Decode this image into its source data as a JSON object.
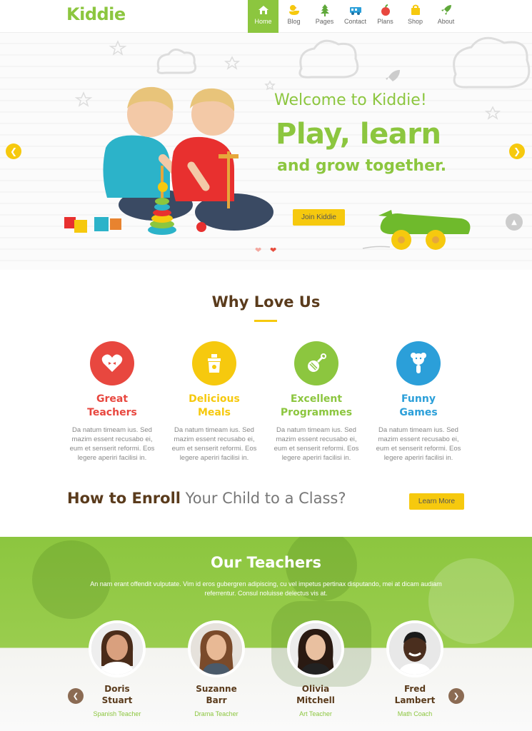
{
  "header": {
    "logo": "Kiddie",
    "nav": [
      {
        "label": "Home",
        "icon": "home-icon",
        "active": true
      },
      {
        "label": "Blog",
        "icon": "duck-icon"
      },
      {
        "label": "Pages",
        "icon": "tree-icon"
      },
      {
        "label": "Contact",
        "icon": "train-icon"
      },
      {
        "label": "Plans",
        "icon": "apple-icon"
      },
      {
        "label": "Shop",
        "icon": "bag-icon"
      },
      {
        "label": "About",
        "icon": "rocket-icon"
      }
    ]
  },
  "hero": {
    "welcome": "Welcome to Kiddie!",
    "headline": "Play, learn",
    "subheadline": "and grow together.",
    "cta": "Join Kiddie"
  },
  "why": {
    "title": "Why Love Us",
    "features": [
      {
        "title_line1": "Great",
        "title_line2": "Teachers",
        "color": "#e8473f",
        "icon": "heart-icon",
        "desc": [
          "Da natum timeam ius. Sed",
          "mazim essent recusabo ei,",
          "eum et senserit reformi. Eos",
          "legere aperiri facilisi in."
        ]
      },
      {
        "title_line1": "Delicious",
        "title_line2": "Meals",
        "color": "#f6c90e",
        "icon": "baby-food-icon",
        "desc": [
          "Da natum timeam ius. Sed",
          "mazim essent recusabo ei,",
          "eum et senserit reformi. Eos",
          "legere aperiri facilisi in."
        ]
      },
      {
        "title_line1": "Excellent",
        "title_line2": "Programmes",
        "color": "#8cc63f",
        "icon": "rattle-icon",
        "desc": [
          "Da natum timeam ius. Sed",
          "mazim essent recusabo ei,",
          "eum et senserit reformi. Eos",
          "legere aperiri facilisi in."
        ]
      },
      {
        "title_line1": "Funny",
        "title_line2": "Games",
        "color": "#2b9fd9",
        "icon": "teddy-bear-icon",
        "desc": [
          "Da natum timeam ius. Sed",
          "mazim essent recusabo ei,",
          "eum et senserit reformi. Eos",
          "legere aperiri facilisi in."
        ]
      }
    ]
  },
  "enroll": {
    "bold": "How to Enroll",
    "rest": "Your Child to a Class?",
    "button": "Learn More"
  },
  "teachers": {
    "title": "Our Teachers",
    "desc": "An nam erant offendit vulputate. Vim id eros gubergren adipiscing, cu vel impetus pertinax disputando, mei at dicam audiam referrentur. Consul noluisse delectus vis at.",
    "list": [
      {
        "first": "Doris",
        "last": "Stuart",
        "role": "Spanish Teacher"
      },
      {
        "first": "Suzanne",
        "last": "Barr",
        "role": "Drama Teacher"
      },
      {
        "first": "Olivia",
        "last": "Mitchell",
        "role": "Art Teacher"
      },
      {
        "first": "Fred",
        "last": "Lambert",
        "role": "Math Coach"
      }
    ]
  },
  "colors": {
    "brand_green": "#8cc63f",
    "yellow": "#f6c90e",
    "brown": "#5a3b1c",
    "red": "#e8473f",
    "blue": "#2b9fd9"
  }
}
